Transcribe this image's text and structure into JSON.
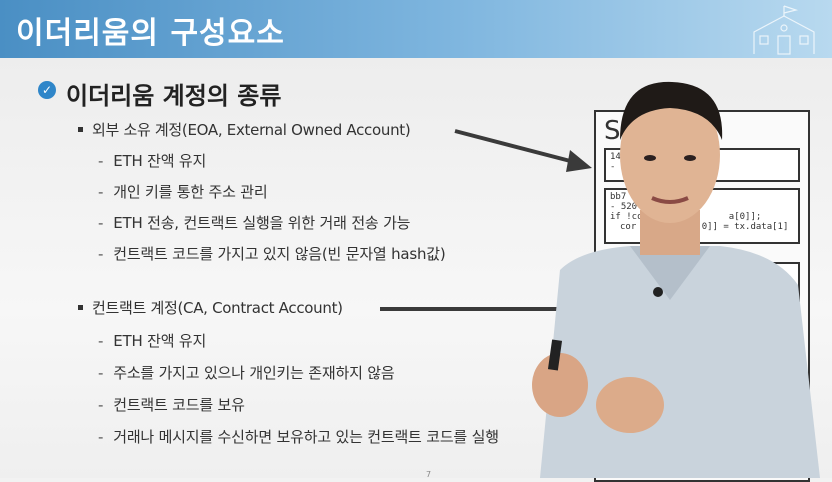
{
  "header": {
    "title": "이더리움의 구성요소"
  },
  "section": {
    "title": "이더리움 계정의 종류"
  },
  "eoa": {
    "heading": "외부 소유 계정(EOA, External Owned Account)",
    "items": [
      "ETH 잔액 유지",
      "개인 키를 통한 주소 관리",
      "ETH 전송, 컨트랙트 실행을 위한 거래 전송 가능",
      "컨트랙트 코드를 가지고 있지 않음(빈 문자열 hash값)"
    ]
  },
  "ca": {
    "heading": "컨트랙트 계정(CA, Contract Account)",
    "items": [
      "ETH 잔액 유지",
      "주소를 가지고 있으나 개인키는 존재하지 않음",
      "컨트랙트 코드를 보유",
      "거래나 메시지를 수신하면 보유하고 있는 컨트랙트 코드를 실행"
    ]
  },
  "code_slide": {
    "heading": "S",
    "box1": [
      "14",
      "- 1"
    ],
    "box2": [
      "bb7",
      "- 520",
      "if !cont",
      "cor",
      "a[0]];",
      "0]] = tx.data[1]"
    ]
  },
  "page_number": "7",
  "colors": {
    "header_start": "#4a8fc4",
    "header_end": "#b8d9ef",
    "check": "#2f86c9"
  }
}
